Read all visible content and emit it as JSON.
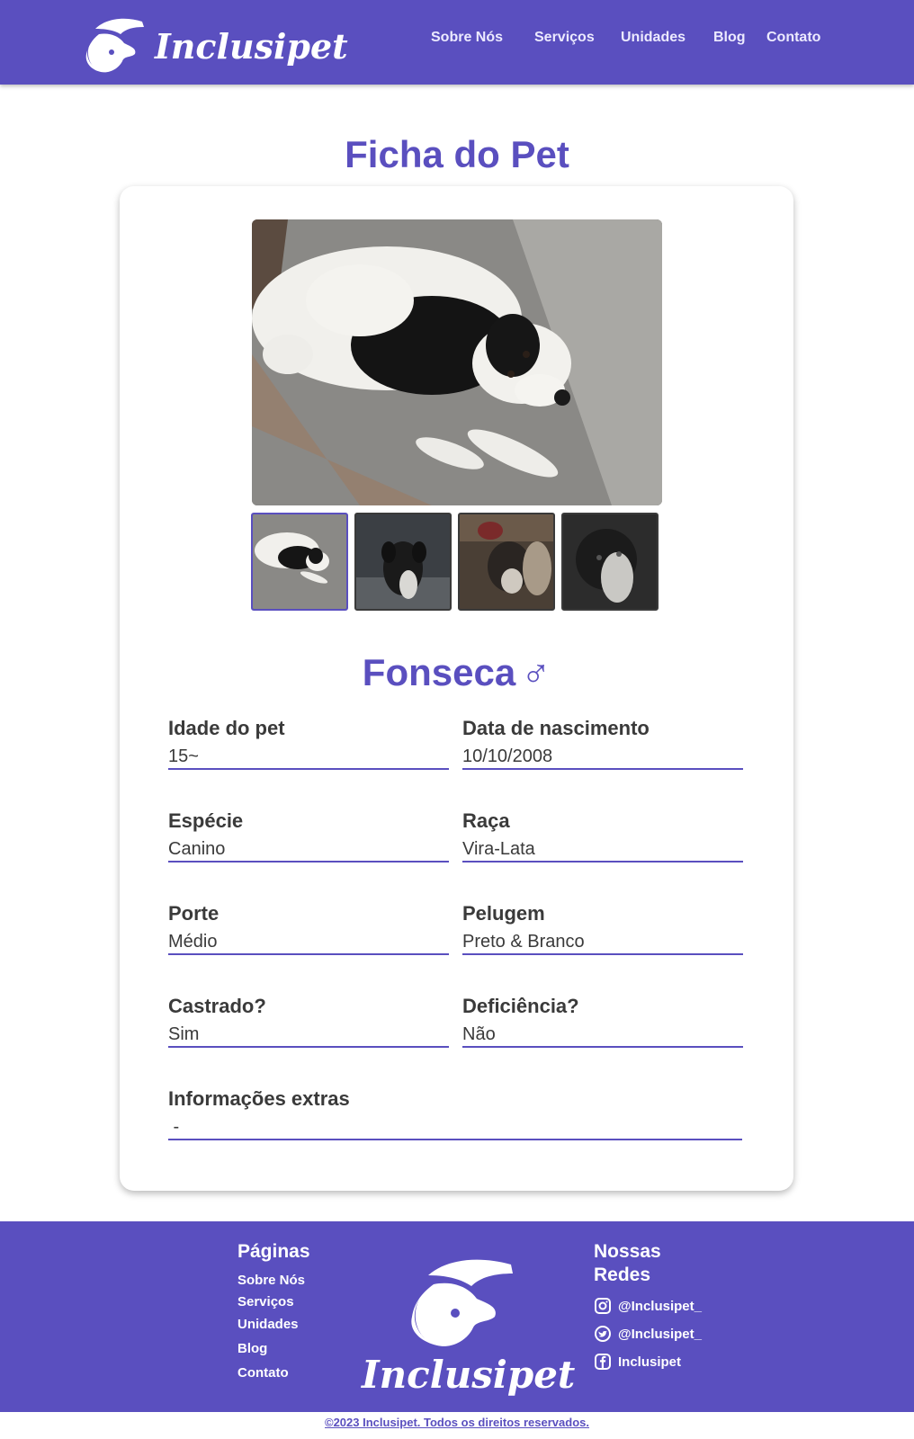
{
  "header": {
    "brand": "Inclusipet",
    "nav": [
      "Sobre Nós",
      "Serviços",
      "Unidades",
      "Blog",
      "Contato"
    ]
  },
  "page": {
    "title": "Ficha do Pet"
  },
  "pet": {
    "name": "Fonseca",
    "sex_symbol": "♂",
    "fields": {
      "idade": {
        "label": "Idade do pet",
        "value": "15~"
      },
      "nascimento": {
        "label": "Data de nascimento",
        "value": "10/10/2008"
      },
      "especie": {
        "label": "Espécie",
        "value": "Canino"
      },
      "raca": {
        "label": "Raça",
        "value": "Vira-Lata"
      },
      "porte": {
        "label": "Porte",
        "value": "Médio"
      },
      "pelugem": {
        "label": "Pelugem",
        "value": "Preto & Branco"
      },
      "castrado": {
        "label": "Castrado?",
        "value": "Sim"
      },
      "deficiencia": {
        "label": "Deficiência?",
        "value": "Não"
      },
      "extras": {
        "label": "Informações extras",
        "value": " -"
      }
    }
  },
  "footer": {
    "pages_title": "Páginas",
    "pages": [
      "Sobre Nós",
      "Serviços",
      "Unidades",
      "Blog",
      "Contato"
    ],
    "brand": "Inclusipet",
    "social_title_1": "Nossas",
    "social_title_2": "Redes",
    "social": [
      {
        "icon": "instagram-icon",
        "label": "@Inclusipet_"
      },
      {
        "icon": "twitter-icon",
        "label": "@Inclusipet_"
      },
      {
        "icon": "facebook-icon",
        "label": "Inclusipet"
      }
    ]
  },
  "copyright": "©2023 Inclusipet. Todos os direitos reservados.",
  "colors": {
    "brand": "#5a4fbf",
    "text": "#3a3a3a"
  }
}
